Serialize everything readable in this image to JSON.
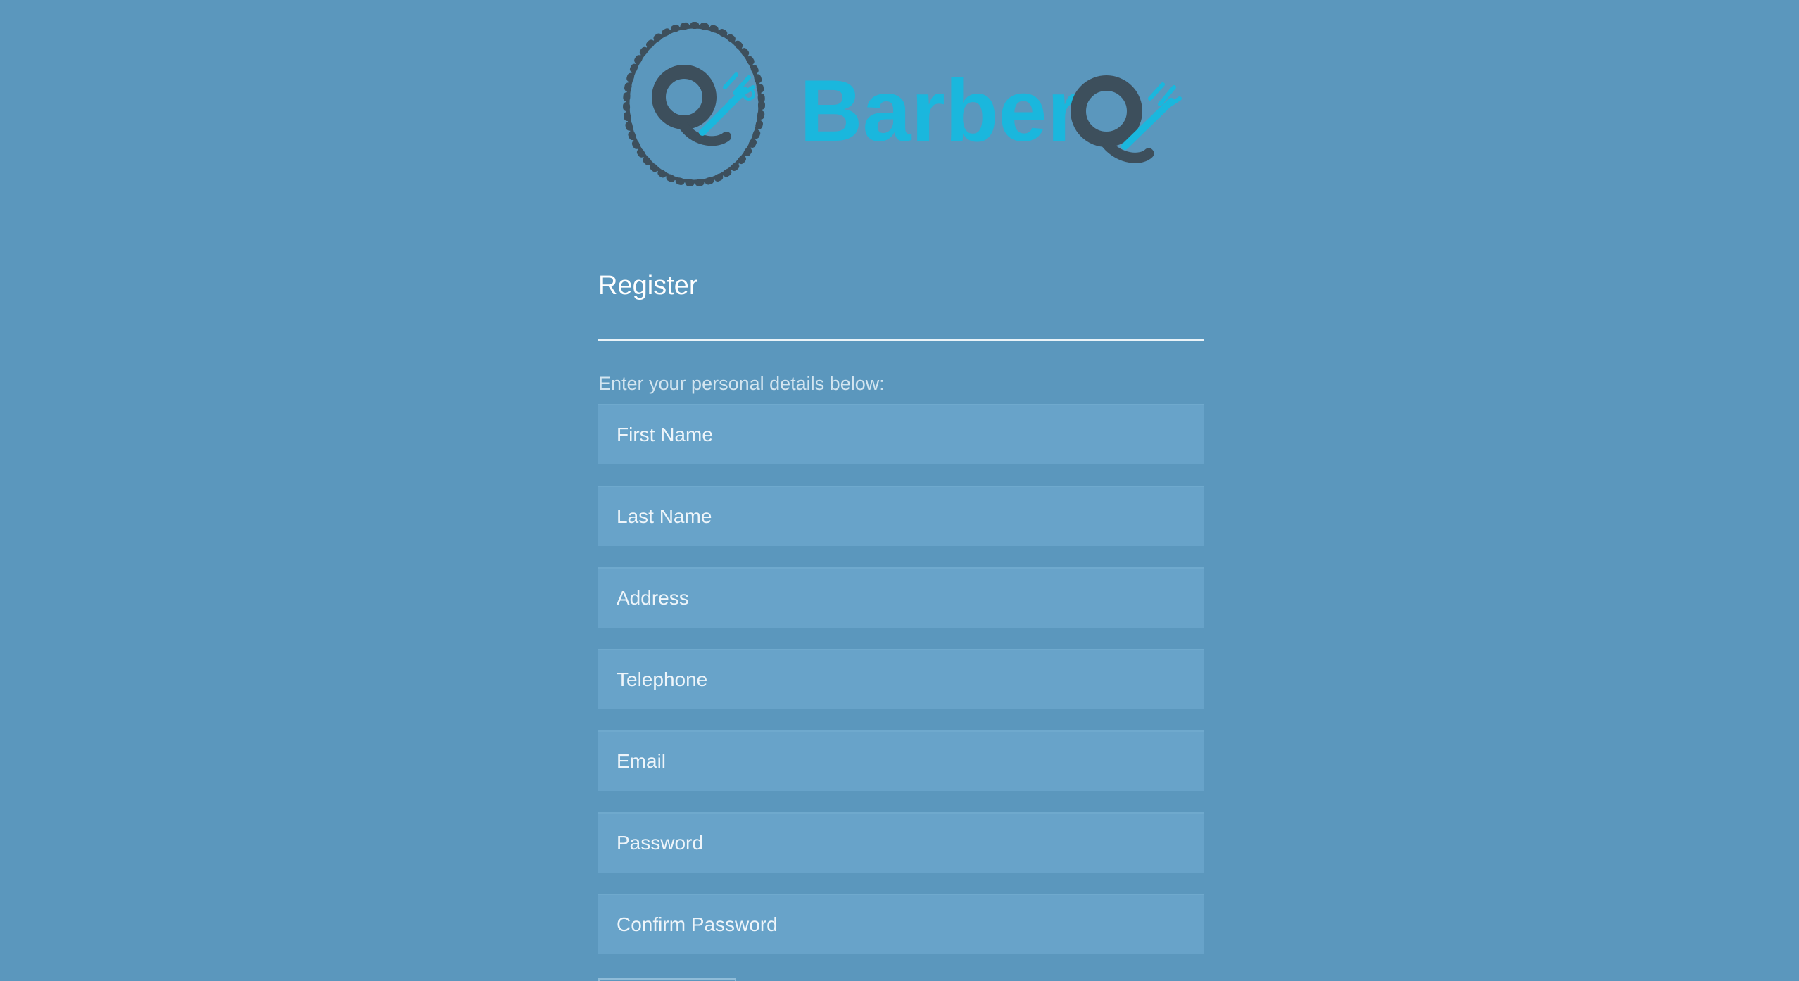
{
  "logo": {
    "brand_text": "BarberQ",
    "brand_prefix": "Barber",
    "brand_suffix": "Q",
    "colors": {
      "accent": "#1ab7dd",
      "dark": "#3d4f5c"
    }
  },
  "form": {
    "title": "Register",
    "subtitle": "Enter your personal details below:",
    "fields": {
      "first_name": "First Name",
      "last_name": "Last Name",
      "address": "Address",
      "telephone": "Telephone",
      "email": "Email",
      "password": "Password",
      "confirm_password": "Confirm Password"
    }
  },
  "colors": {
    "background": "#5b97bd",
    "input_background": "#68a3c9",
    "text": "#ffffff"
  }
}
